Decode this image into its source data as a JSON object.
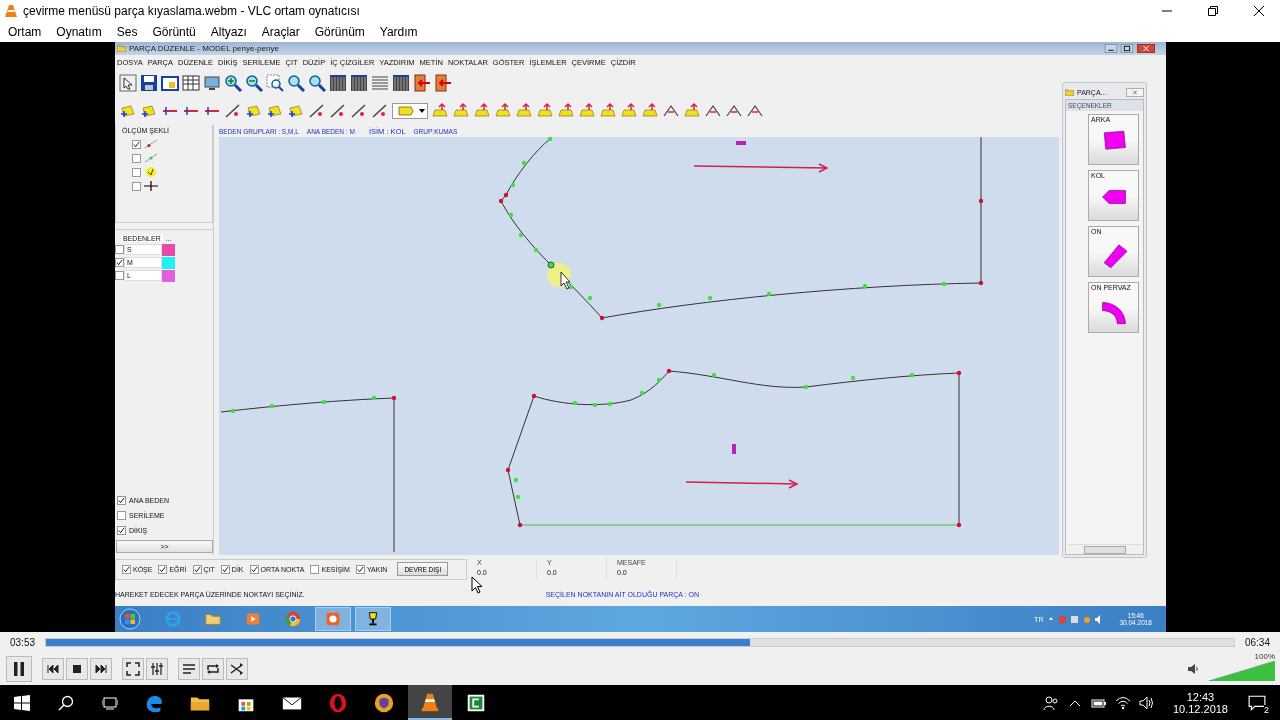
{
  "player": {
    "title": "çevirme menüsü parça kıyaslama.webm - VLC ortam oynatıcısı",
    "menu": [
      "Ortam",
      "Oynatım",
      "Ses",
      "Görüntü",
      "Altyazı",
      "Araçlar",
      "Görünüm",
      "Yardım"
    ],
    "time_elapsed": "03:53",
    "time_total": "06:34",
    "progress": {
      "level": 0.593
    },
    "volume": {
      "reading": "100%",
      "level": 1.0
    }
  },
  "app": {
    "title": "PARÇA DÜZENLE - MODEL penye-penye",
    "menu": [
      "DOSYA",
      "PARÇA",
      "DÜZENLE",
      "DİKİŞ",
      "SERİLEME",
      "ÇIT",
      "DÜZİP",
      "İÇ ÇİZGİLER",
      "YAZDIRIM",
      "METİN",
      "NOKTALAR",
      "GÖSTER",
      "İŞLEMLER",
      "ÇEVİRME",
      "ÇİZDİR"
    ],
    "info": [
      {
        "text": "BEDEN GRUPLARI : S,M,L"
      },
      {
        "text": "ANA BEDEN : M"
      },
      {
        "text": "İSİM : KOL"
      },
      {
        "text": "GRUP:KUMAS"
      }
    ],
    "measure_panel": {
      "title": "ÖLÇÜM ŞEKLİ",
      "options": [
        {
          "kind": "endpoint",
          "checked": true
        },
        {
          "kind": "midpoint",
          "checked": false
        },
        {
          "kind": "highlight",
          "checked": false
        },
        {
          "kind": "cross",
          "checked": false
        }
      ]
    },
    "sizes": {
      "header": "BEDENLER",
      "more": "...",
      "rows": [
        {
          "label": "S",
          "checked": false,
          "color": "#e84aa8"
        },
        {
          "label": "M",
          "checked": true,
          "color": "#22f0f0"
        },
        {
          "label": "L",
          "checked": false,
          "color": "#e060e0"
        }
      ]
    },
    "view_options": [
      {
        "label": "ANA BEDEN",
        "checked": true
      },
      {
        "label": "SERİLEME",
        "checked": false
      },
      {
        "label": "DİKİŞ",
        "checked": true
      }
    ],
    "expand_button": ">>",
    "pieces_panel": {
      "title": "PARÇA...",
      "section": "SEÇENEKLER",
      "pieces": [
        {
          "name": "ARKA"
        },
        {
          "name": "KOL"
        },
        {
          "name": "ON"
        },
        {
          "name": "ON PERVAZ"
        }
      ]
    },
    "snap_options": [
      {
        "label": "KÖŞE",
        "checked": true
      },
      {
        "label": "EĞRİ",
        "checked": true
      },
      {
        "label": "ÇIT",
        "checked": true
      },
      {
        "label": "DİK",
        "checked": true
      },
      {
        "label": "ORTA NOKTA",
        "checked": true
      },
      {
        "label": "KESİŞİM",
        "checked": false
      },
      {
        "label": "YAKIN",
        "checked": true
      }
    ],
    "disable_button": "DEVRE DIŞI",
    "coords": [
      {
        "label": "X",
        "value": "0.0"
      },
      {
        "label": "Y",
        "value": "0.0"
      },
      {
        "label": "MESAFE",
        "value": "0.0"
      }
    ],
    "status_left": "HAREKET EDECEK PARÇA ÜZERİNDE NOKTAYI SEÇİNİZ.",
    "status_right": "SEÇİLEN NOKTANIN AİT OLDUĞU PARÇA : ON"
  },
  "inner_taskbar": {
    "language": "TR",
    "time": "15:46",
    "date": "30.04.2018"
  },
  "desktop_taskbar": {
    "time": "12:43",
    "date": "10.12.2018",
    "notifications": "2"
  }
}
